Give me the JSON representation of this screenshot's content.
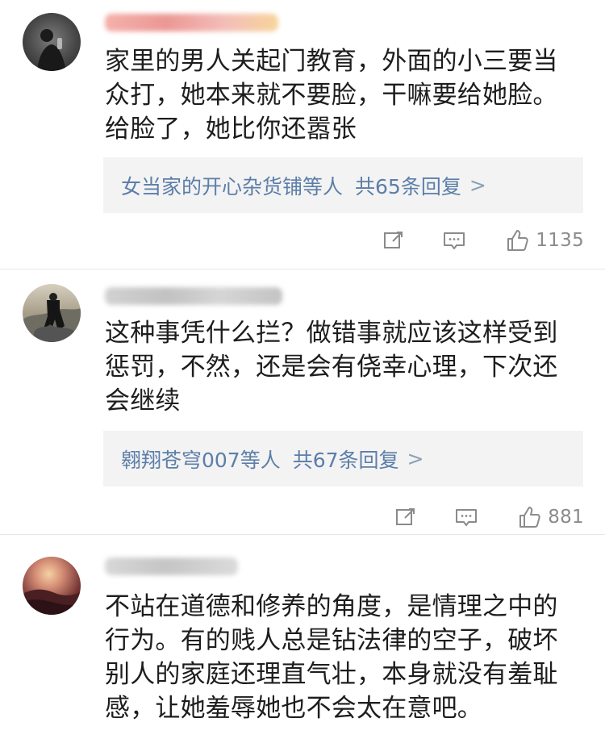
{
  "comments": [
    {
      "text": "家里的男人关起门教育，外面的小三要当众打，她本来就不要脸，干嘛要给她脸。给脸了，她比你还嚣张",
      "reply_summary": {
        "label": "女当家的开心杂货铺等人",
        "count_text": "共65条回复",
        "chevron": ">"
      },
      "actions": {
        "share_icon": "share-edit-icon",
        "comment_icon": "comment-icon",
        "like_icon": "thumbs-up-icon",
        "likes": "1135"
      }
    },
    {
      "text": "这种事凭什么拦？做错事就应该这样受到惩罚，不然，还是会有侥幸心理，下次还会继续",
      "reply_summary": {
        "label": "翱翔苍穹007等人",
        "count_text": "共67条回复",
        "chevron": ">"
      },
      "actions": {
        "share_icon": "share-edit-icon",
        "comment_icon": "comment-icon",
        "like_icon": "thumbs-up-icon",
        "likes": "881"
      }
    },
    {
      "text": "不站在道德和修养的角度，是情理之中的行为。有的贱人总是钻法律的空子，破坏别人的家庭还理直气壮，本身就没有羞耻感，让她羞辱她也不会太在意吧。"
    }
  ],
  "colors": {
    "reply_link": "#5c7ea8",
    "reply_background": "#f3f3f3",
    "icon_gray": "#8b8b8b",
    "divider": "#e7e7e7"
  }
}
